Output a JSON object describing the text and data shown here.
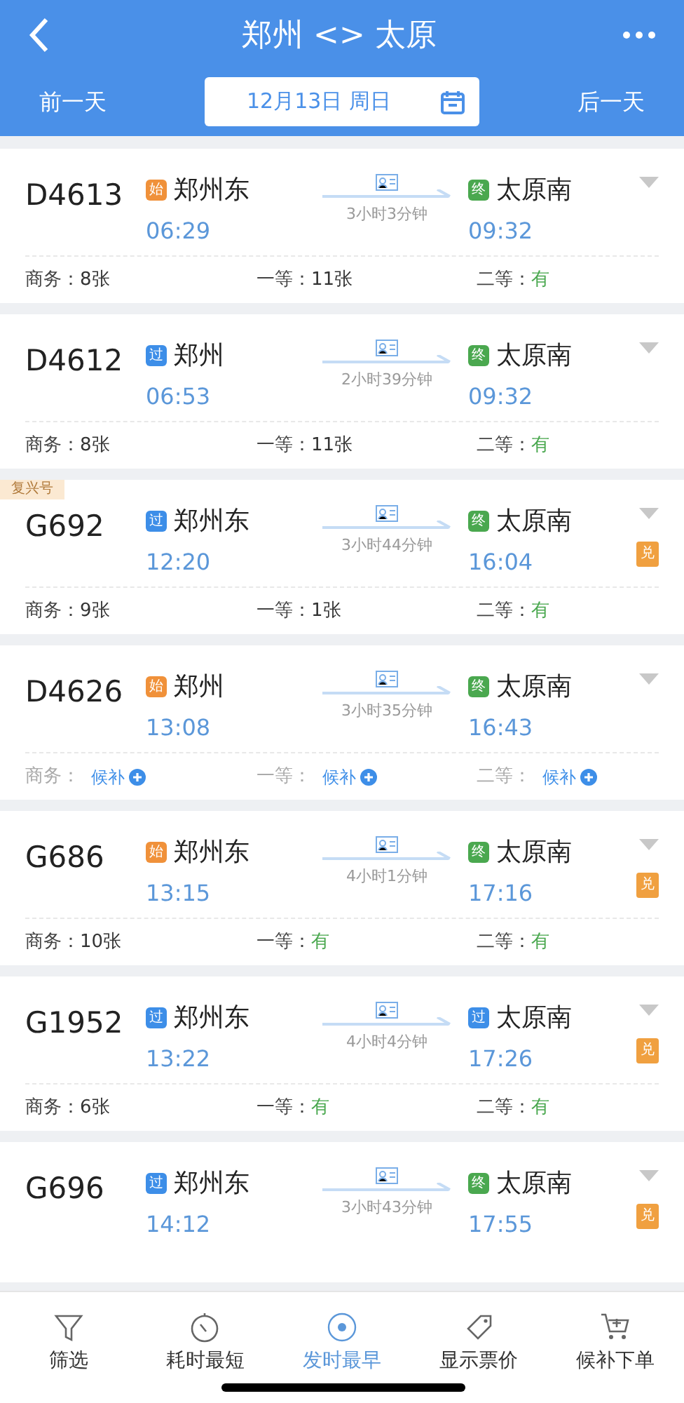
{
  "header": {
    "title": "郑州 <> 太原",
    "prev_day": "前一天",
    "date": "12月13日 周日",
    "next_day": "后一天"
  },
  "trains": [
    {
      "number": "D4613",
      "from": {
        "badge": "始",
        "color": "#f0913a",
        "station": "郑州东",
        "time": "06:29"
      },
      "duration": "3小时3分钟",
      "to": {
        "badge": "终",
        "color": "#4aa84f",
        "station": "太原南",
        "time": "09:32"
      },
      "seats": [
        {
          "label": "商务：",
          "value": "8张",
          "kind": "count"
        },
        {
          "label": "一等：",
          "value": "11张",
          "kind": "count"
        },
        {
          "label": "二等：",
          "value": "有",
          "kind": "available"
        }
      ]
    },
    {
      "number": "D4612",
      "from": {
        "badge": "过",
        "color": "#3d8ee8",
        "station": "郑州",
        "time": "06:53"
      },
      "duration": "2小时39分钟",
      "to": {
        "badge": "终",
        "color": "#4aa84f",
        "station": "太原南",
        "time": "09:32"
      },
      "seats": [
        {
          "label": "商务：",
          "value": "8张",
          "kind": "count"
        },
        {
          "label": "一等：",
          "value": "11张",
          "kind": "count"
        },
        {
          "label": "二等：",
          "value": "有",
          "kind": "available"
        }
      ]
    },
    {
      "tag": "复兴号",
      "number": "G692",
      "from": {
        "badge": "过",
        "color": "#3d8ee8",
        "station": "郑州东",
        "time": "12:20"
      },
      "duration": "3小时44分钟",
      "to": {
        "badge": "终",
        "color": "#4aa84f",
        "station": "太原南",
        "time": "16:04"
      },
      "exchange": "兑",
      "seats": [
        {
          "label": "商务：",
          "value": "9张",
          "kind": "count"
        },
        {
          "label": "一等：",
          "value": "1张",
          "kind": "count"
        },
        {
          "label": "二等：",
          "value": "有",
          "kind": "available"
        }
      ]
    },
    {
      "number": "D4626",
      "from": {
        "badge": "始",
        "color": "#f0913a",
        "station": "郑州",
        "time": "13:08"
      },
      "duration": "3小时35分钟",
      "to": {
        "badge": "终",
        "color": "#4aa84f",
        "station": "太原南",
        "time": "16:43"
      },
      "seats": [
        {
          "label": "商务：",
          "value": "候补",
          "kind": "waitlist"
        },
        {
          "label": "一等：",
          "value": "候补",
          "kind": "waitlist"
        },
        {
          "label": "二等：",
          "value": "候补",
          "kind": "waitlist"
        }
      ]
    },
    {
      "number": "G686",
      "from": {
        "badge": "始",
        "color": "#f0913a",
        "station": "郑州东",
        "time": "13:15"
      },
      "duration": "4小时1分钟",
      "to": {
        "badge": "终",
        "color": "#4aa84f",
        "station": "太原南",
        "time": "17:16"
      },
      "exchange": "兑",
      "seats": [
        {
          "label": "商务：",
          "value": "10张",
          "kind": "count"
        },
        {
          "label": "一等：",
          "value": "有",
          "kind": "available"
        },
        {
          "label": "二等：",
          "value": "有",
          "kind": "available"
        }
      ]
    },
    {
      "number": "G1952",
      "from": {
        "badge": "过",
        "color": "#3d8ee8",
        "station": "郑州东",
        "time": "13:22"
      },
      "duration": "4小时4分钟",
      "to": {
        "badge": "过",
        "color": "#3d8ee8",
        "station": "太原南",
        "time": "17:26"
      },
      "exchange": "兑",
      "seats": [
        {
          "label": "商务：",
          "value": "6张",
          "kind": "count"
        },
        {
          "label": "一等：",
          "value": "有",
          "kind": "available"
        },
        {
          "label": "二等：",
          "value": "有",
          "kind": "available"
        }
      ]
    },
    {
      "number": "G696",
      "from": {
        "badge": "过",
        "color": "#3d8ee8",
        "station": "郑州东",
        "time": "14:12"
      },
      "duration": "3小时43分钟",
      "to": {
        "badge": "终",
        "color": "#4aa84f",
        "station": "太原南",
        "time": "17:55"
      },
      "exchange": "兑"
    }
  ],
  "toolbar": [
    {
      "kind": "filter",
      "label": "筛选",
      "selected": false
    },
    {
      "kind": "duration",
      "label": "耗时最短",
      "selected": false
    },
    {
      "kind": "depart",
      "label": "发时最早",
      "selected": true
    },
    {
      "kind": "price",
      "label": "显示票价",
      "selected": false
    },
    {
      "kind": "waitlist",
      "label": "候补下单",
      "selected": false
    }
  ]
}
